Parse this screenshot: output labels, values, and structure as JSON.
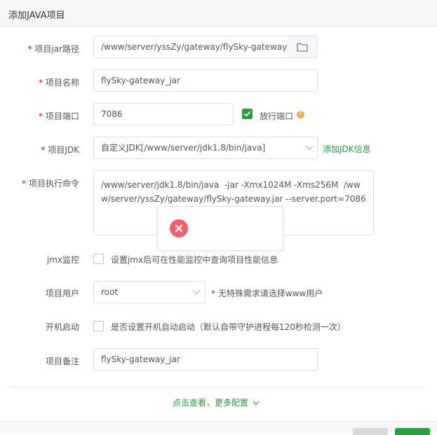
{
  "dialog": {
    "title": "添加JAVA项目"
  },
  "form": {
    "jar_path": {
      "label": "项目jar路径",
      "value": "/www/server/yssZy/gateway/flySky-gateway.",
      "folder_icon": "folder-icon"
    },
    "project_name": {
      "label": "项目名称",
      "value": "flySky-gateway_jar"
    },
    "project_port": {
      "label": "项目端口",
      "value": "7086",
      "allow_port_label": "放行端口",
      "allow_port_checked": true,
      "help_icon": "question-icon",
      "help_glyph": "?"
    },
    "project_jdk": {
      "label": "项目JDK",
      "value": "自定义JDK[/www/server/jdk1.8/bin/java]",
      "add_jdk_link": "添加JDK信息"
    },
    "exec_command": {
      "label": "项目执行命令",
      "value": "/www/server/jdk1.8/bin/java  -jar -Xmx1024M -Xms256M  /www/server/yssZy/gateway/flySky-gateway.jar --server.port=7086"
    },
    "jmx": {
      "label": "jmx监控",
      "checked": false,
      "description": "设置jmx后可在性能监控中查询项目性能信息"
    },
    "project_user": {
      "label": "项目用户",
      "value": "root",
      "hint": "* 无特殊需求请选择www用户"
    },
    "autostart": {
      "label": "开机启动",
      "checked": false,
      "description": "是否设置开机自动启动（默认自带守护进程每120秒检测一次）"
    },
    "remark": {
      "label": "项目备注",
      "value": "flySky-gateway_jar"
    }
  },
  "more_config": {
    "label": "点击查看，更多配置"
  },
  "required_mark": "*",
  "colors": {
    "accent": "#20a53a",
    "required": "#ef0808",
    "error": "#f0626d"
  }
}
